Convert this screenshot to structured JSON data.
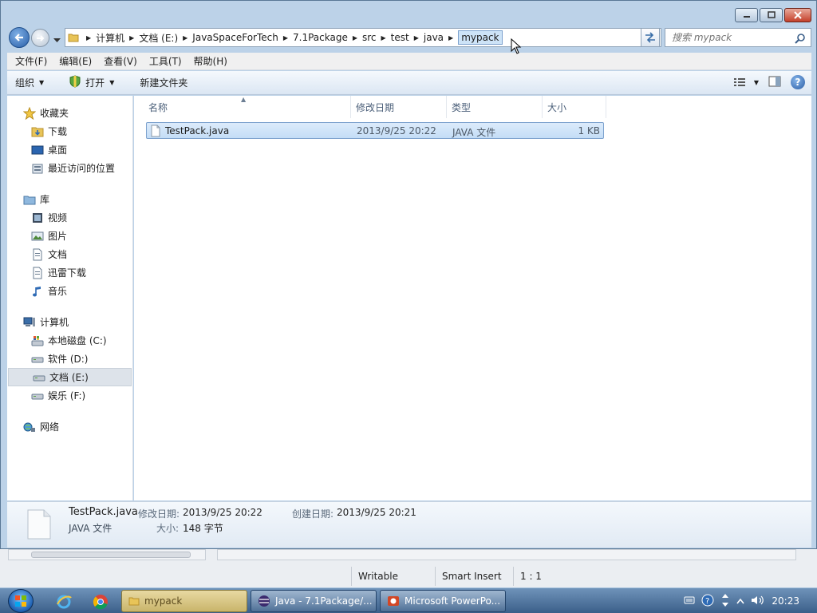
{
  "address_bar": {
    "crumbs": [
      "计算机",
      "文档 (E:)",
      "JavaSpaceForTech",
      "7.1Package",
      "src",
      "test",
      "java",
      "mypack"
    ],
    "search_placeholder": "搜索 mypack"
  },
  "menubar": [
    "文件(F)",
    "编辑(E)",
    "查看(V)",
    "工具(T)",
    "帮助(H)"
  ],
  "toolbar": {
    "organize": "组织",
    "open": "打开",
    "new_folder": "新建文件夹"
  },
  "sidebar": {
    "favorites": {
      "label": "收藏夹",
      "items": [
        "下载",
        "桌面",
        "最近访问的位置"
      ]
    },
    "libraries": {
      "label": "库",
      "items": [
        "视频",
        "图片",
        "文档",
        "迅雷下载",
        "音乐"
      ]
    },
    "computer": {
      "label": "计算机",
      "items": [
        "本地磁盘 (C:)",
        "软件 (D:)",
        "文档 (E:)",
        "娱乐 (F:)"
      ],
      "selected": "文档 (E:)"
    },
    "network": {
      "label": "网络"
    }
  },
  "columns": [
    "名称",
    "修改日期",
    "类型",
    "大小"
  ],
  "files": [
    {
      "name": "TestPack.java",
      "modified": "2013/9/25 20:22",
      "type": "JAVA 文件",
      "size": "1 KB"
    }
  ],
  "details": {
    "filename": "TestPack.java",
    "type": "JAVA 文件",
    "modified_label": "修改日期:",
    "modified": "2013/9/25 20:22",
    "created_label": "创建日期:",
    "created": "2013/9/25 20:21",
    "size_label": "大小:",
    "size": "148 字节"
  },
  "editor_status": {
    "writable": "Writable",
    "insert_mode": "Smart Insert",
    "position": "1 : 1"
  },
  "taskbar": {
    "tasks": [
      "mypack",
      "Java - 7.1Package/...",
      "Microsoft PowerPo..."
    ],
    "clock": "20:23"
  },
  "colors": {
    "selection": "#cde3f7",
    "selection_border": "#7da2ce",
    "taskbar": "#3b5f89"
  }
}
